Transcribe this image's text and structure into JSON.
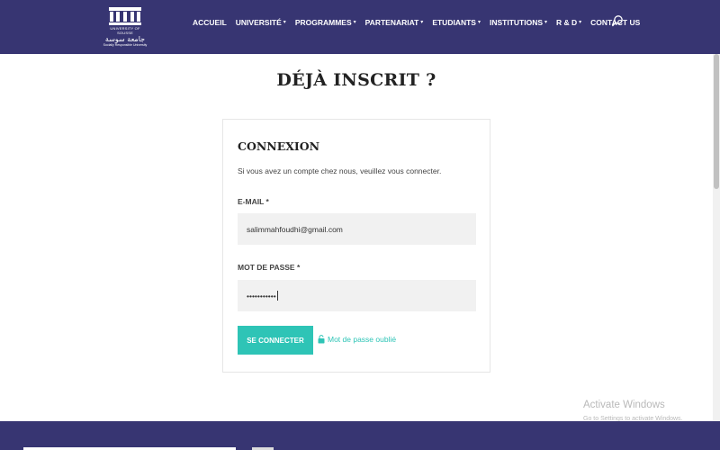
{
  "header": {
    "logo": {
      "line1": "UNIVERSITY OF SOUSSE",
      "line2": "جامعة سوسة",
      "line3": "Socially Responsible University"
    },
    "nav": [
      {
        "label": "ACCUEIL",
        "has_dropdown": false
      },
      {
        "label": "UNIVERSITÉ",
        "has_dropdown": true
      },
      {
        "label": "PROGRAMMES",
        "has_dropdown": true
      },
      {
        "label": "PARTENARIAT",
        "has_dropdown": true
      },
      {
        "label": "ETUDIANTS",
        "has_dropdown": true
      },
      {
        "label": "INSTITUTIONS",
        "has_dropdown": true
      },
      {
        "label": "R & D",
        "has_dropdown": true
      },
      {
        "label": "CONTACT US",
        "has_dropdown": false
      }
    ],
    "search_icon": "search-icon",
    "background_color": "#373572"
  },
  "page": {
    "title": "DÉJÀ INSCRIT ?"
  },
  "login": {
    "title": "CONNEXION",
    "description": "Si vous avez un compte chez nous, veuillez vous connecter.",
    "email_label": "E-MAIL *",
    "email_value": "salimmahfoudhi@gmail.com",
    "password_label": "MOT DE PASSE *",
    "password_value": "•••••••••••",
    "submit_label": "SE CONNECTER",
    "forgot_label": "Mot de passe oublié",
    "accent_color": "#2ec4b6"
  },
  "watermark": {
    "line1": "Activate Windows",
    "line2": "Go to Settings to activate Windows."
  }
}
